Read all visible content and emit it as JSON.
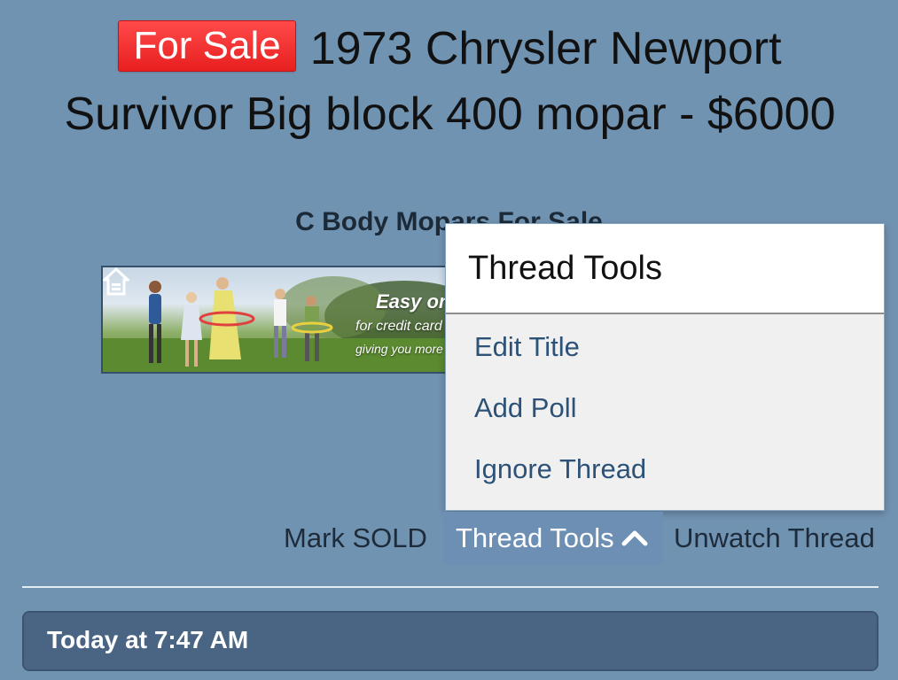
{
  "thread": {
    "prefix": "For Sale",
    "title": "1973 Chrysler Newport Survivor Big block 400 mopar - $6000",
    "forum": "C Body Mopars For Sale"
  },
  "ad": {
    "line1": "Easy onli",
    "line2": "for credit card",
    "line3": "giving you more t"
  },
  "thread_tools_menu": {
    "header": "Thread Tools",
    "items": [
      {
        "label": "Edit Title"
      },
      {
        "label": "Add Poll"
      },
      {
        "label": "Ignore Thread"
      }
    ]
  },
  "actions": {
    "mark_sold": "Mark SOLD",
    "thread_tools": "Thread Tools",
    "unwatch": "Unwatch Thread"
  },
  "post": {
    "timestamp": "Today at 7:47 AM"
  },
  "colors": {
    "background": "#7193b2",
    "prefix_badge": "#e81f1f",
    "menu_link": "#2d5277",
    "post_header": "#4a6584"
  },
  "icons": {
    "thread_tools_toggle": "chevron-up-icon",
    "ad_logo": "house-icon"
  }
}
